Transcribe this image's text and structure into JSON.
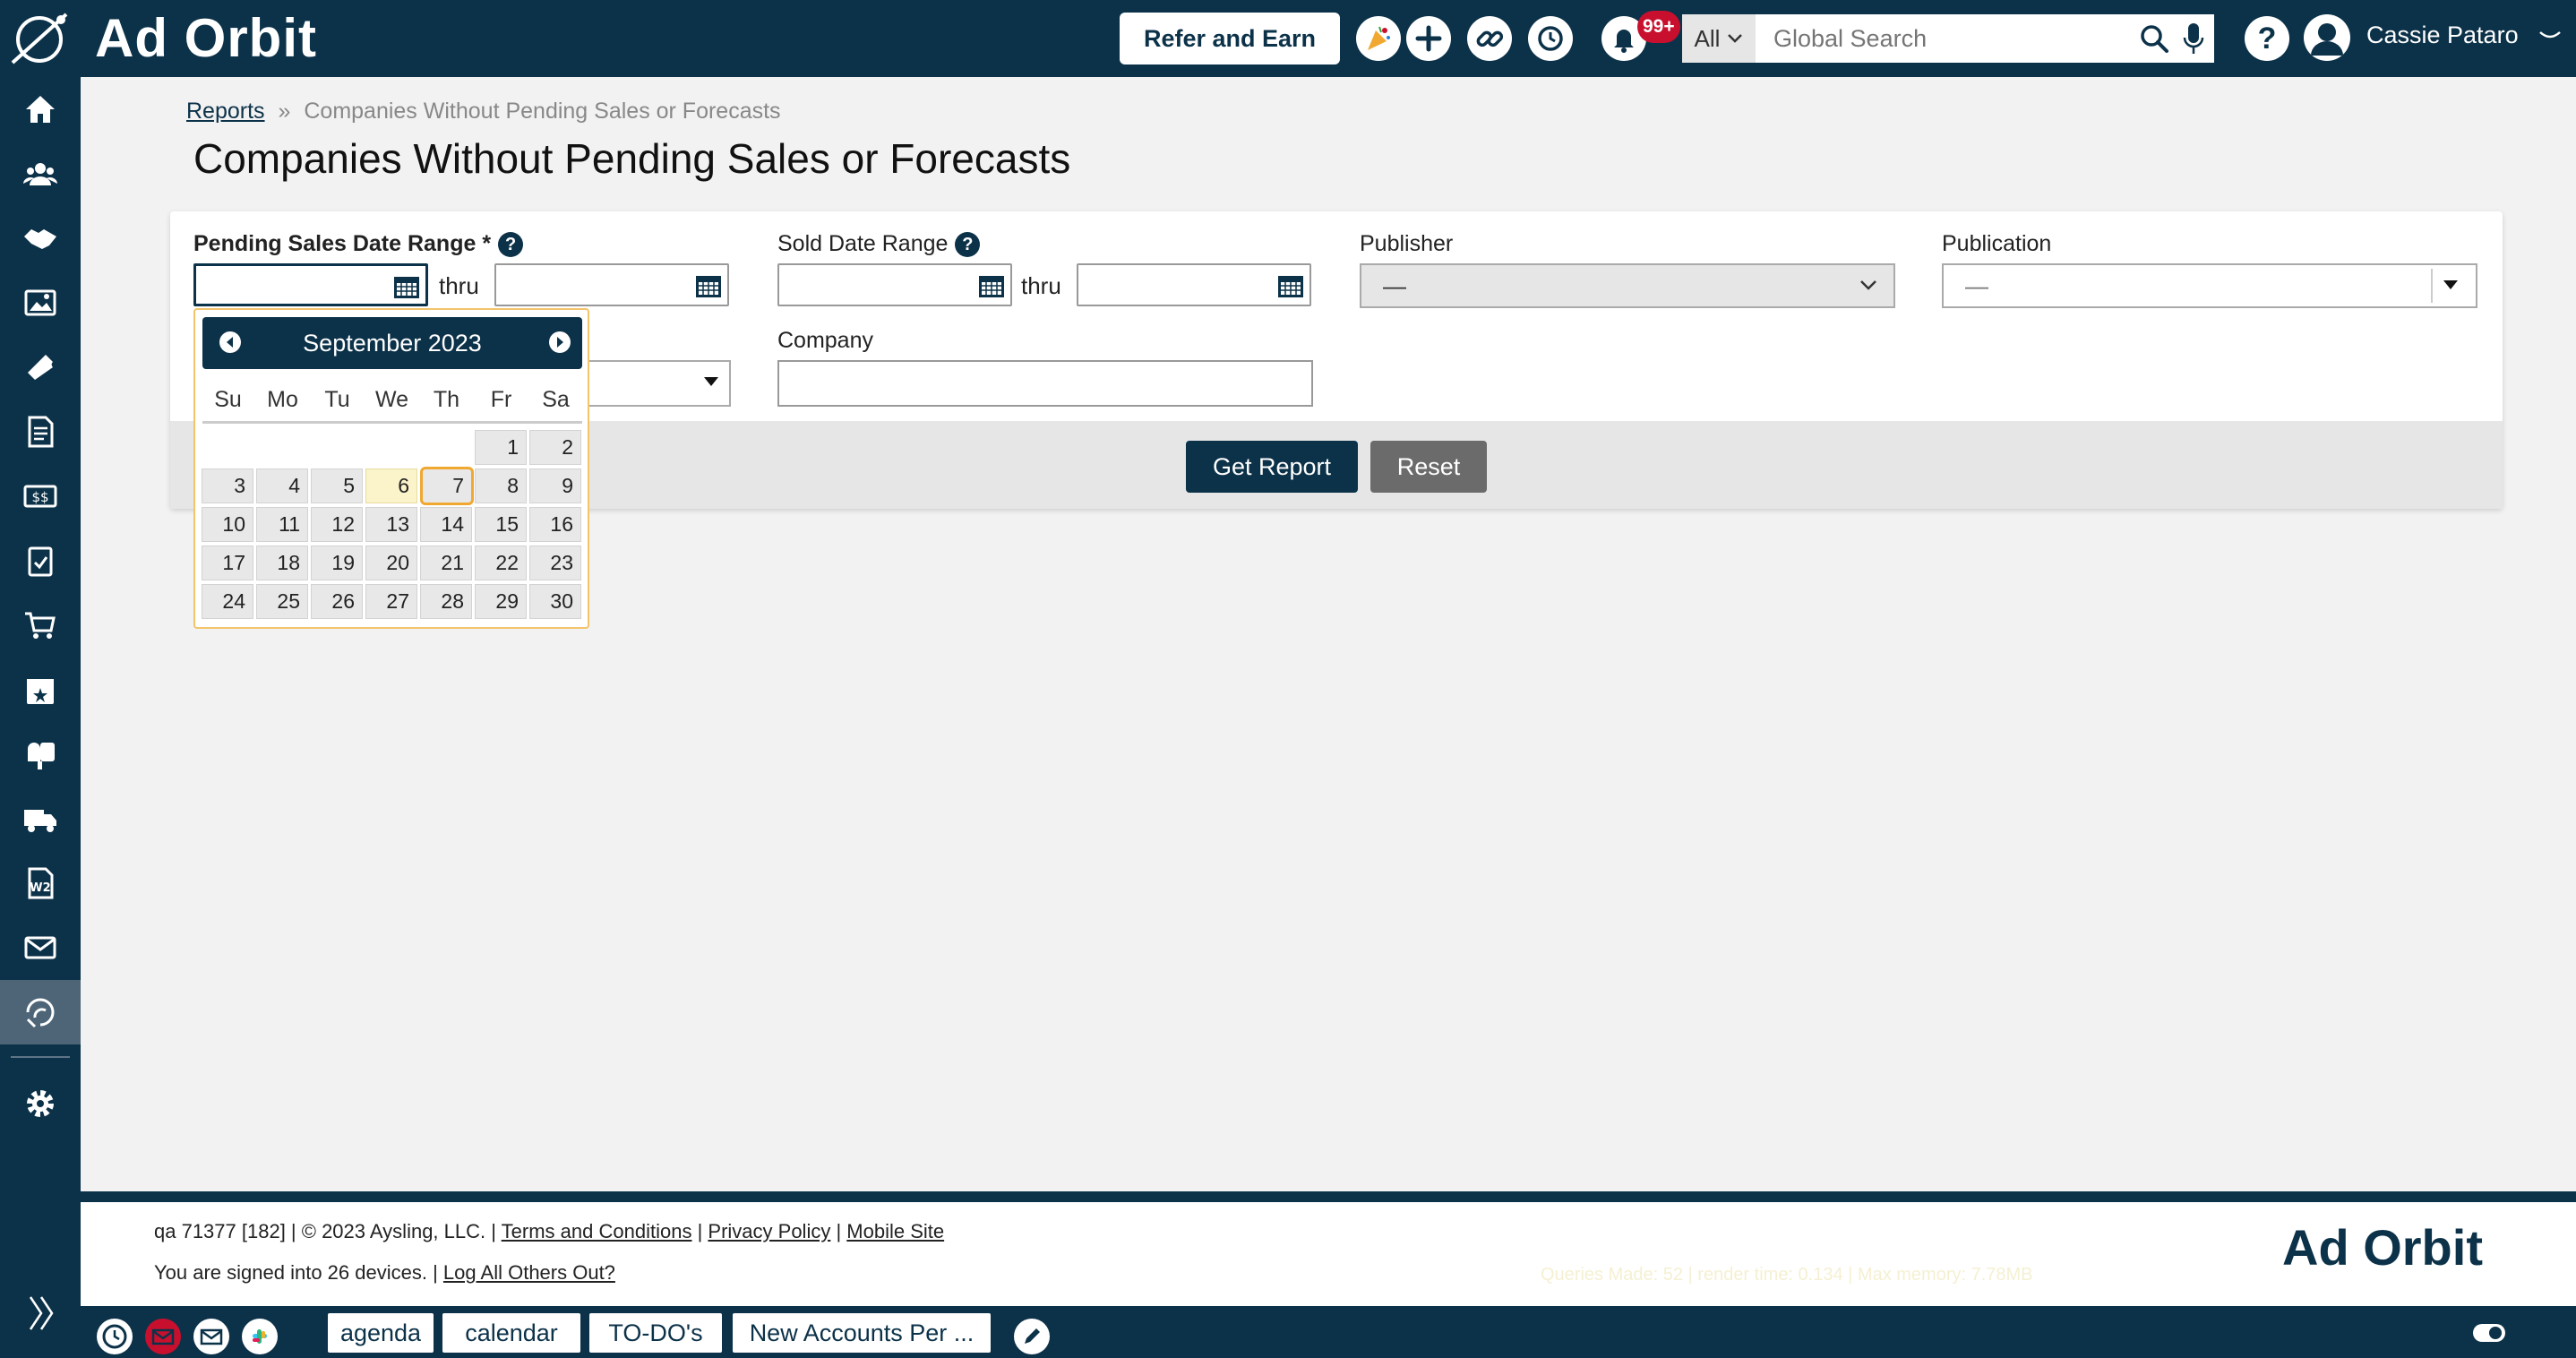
{
  "header": {
    "brand": "Ad Orbit",
    "refer_label": "Refer and Earn",
    "notification_count": "99+",
    "search_scope": "All",
    "search_placeholder": "Global Search",
    "user_name": "Cassie Pataro"
  },
  "breadcrumb": {
    "parent": "Reports",
    "separator": "»",
    "current": "Companies Without Pending Sales or Forecasts"
  },
  "page_title": "Companies Without Pending Sales or Forecasts",
  "form": {
    "pending_label": "Pending Sales Date Range *",
    "sold_label": "Sold Date Range",
    "thru": "thru",
    "publisher_label": "Publisher",
    "publisher_value": "—",
    "publication_label": "Publication",
    "publication_value": "—",
    "company_label": "Company",
    "get_report": "Get Report",
    "reset": "Reset"
  },
  "datepicker": {
    "month_label": "September 2023",
    "weekdays": [
      "Su",
      "Mo",
      "Tu",
      "We",
      "Th",
      "Fr",
      "Sa"
    ],
    "days": [
      "1",
      "2",
      "3",
      "4",
      "5",
      "6",
      "7",
      "8",
      "9",
      "10",
      "11",
      "12",
      "13",
      "14",
      "15",
      "16",
      "17",
      "18",
      "19",
      "20",
      "21",
      "22",
      "23",
      "24",
      "25",
      "26",
      "27",
      "28",
      "29",
      "30"
    ]
  },
  "footer": {
    "build": "qa 71377 [182] | © 2023 Aysling, LLC. |",
    "terms": "Terms and Conditions",
    "privacy": "Privacy Policy",
    "mobile": "Mobile Site",
    "devices": "You are signed into 26 devices. |",
    "logout_others": "Log All Others Out?",
    "logo": "Ad Orbit",
    "perf": "Queries Made: 52 | render time: 0.134 | Max memory: 7.78MB"
  },
  "taskbar": {
    "agenda": "agenda",
    "calendar": "calendar",
    "todos": "TO-DO's",
    "new_accounts": "New Accounts Per ..."
  },
  "colors": {
    "primary": "#0c3249",
    "accent": "#f0a830",
    "badge": "#c8102e",
    "reset": "#6b6b6b"
  }
}
